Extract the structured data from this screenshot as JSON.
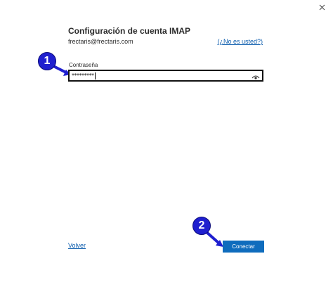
{
  "dialog": {
    "title": "Configuración de cuenta IMAP",
    "email": "frectaris@frectaris.com",
    "not_you_link": "(¿No es usted?)",
    "close_icon": "close-icon"
  },
  "password": {
    "label": "Contraseña",
    "masked_value": "*********",
    "reveal_icon": "eye-icon"
  },
  "footer": {
    "back_link": "Volver",
    "connect_button": "Conectar"
  },
  "annotations": [
    {
      "number": "1"
    },
    {
      "number": "2"
    }
  ],
  "colors": {
    "link": "#0b5cad",
    "primary_button": "#0f6cbd",
    "annotation_badge": "#1f1fcf"
  }
}
